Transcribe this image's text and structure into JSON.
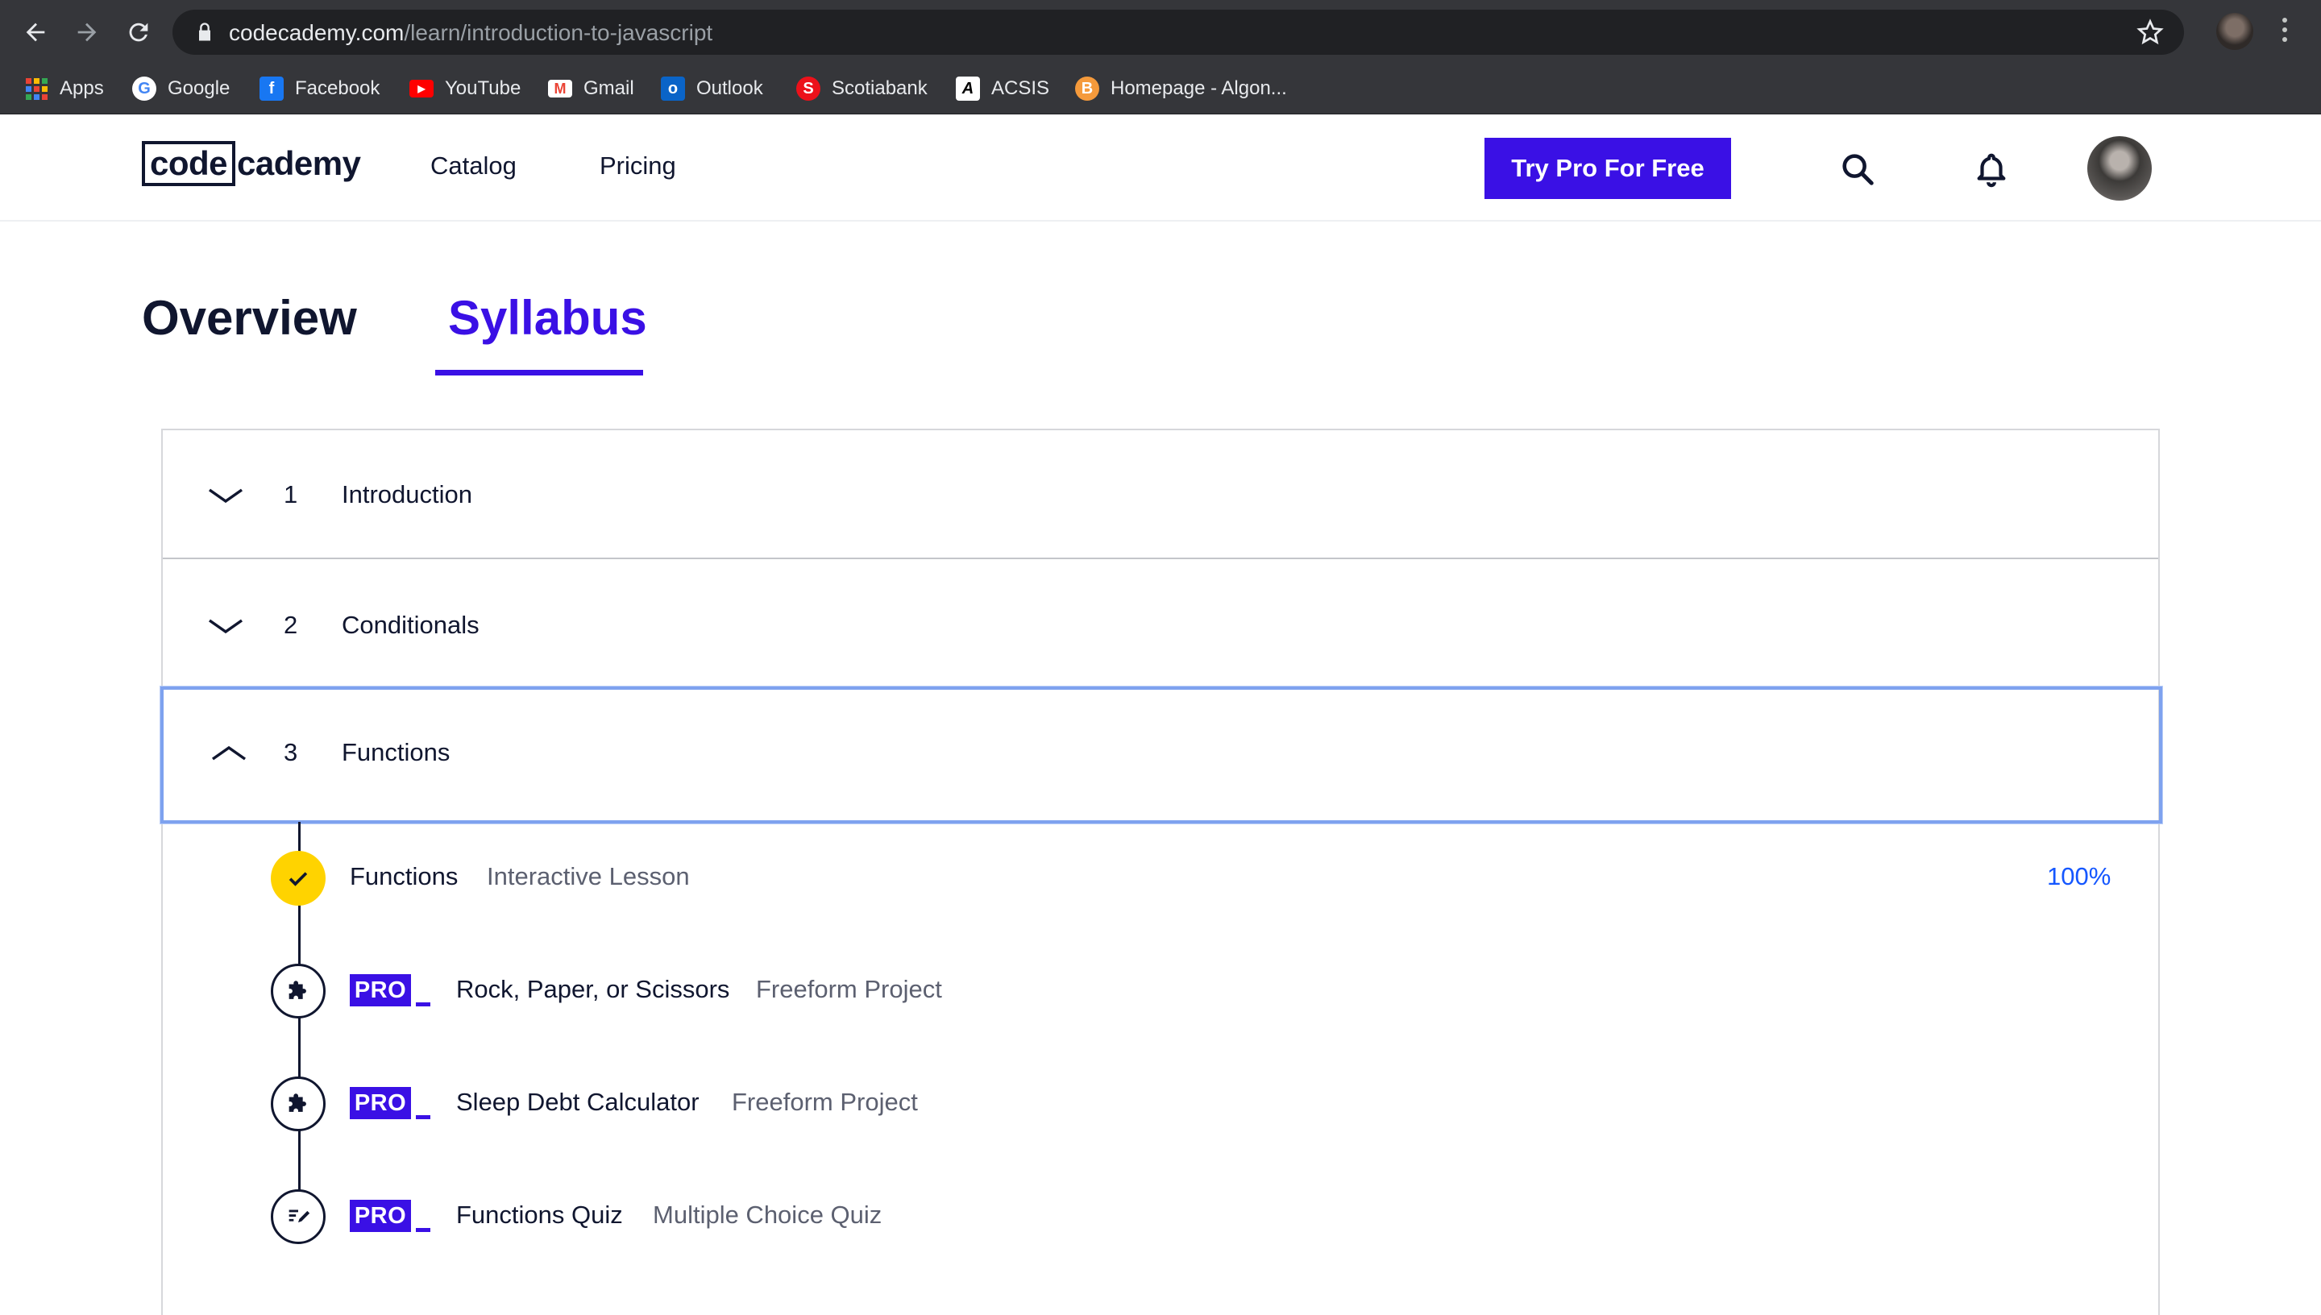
{
  "browser": {
    "url_host": "codecademy.com",
    "url_path": "/learn/introduction-to-javascript",
    "bookmarks": [
      {
        "label": "Apps",
        "icon": "apps-grid-icon"
      },
      {
        "label": "Google",
        "icon": "google-icon"
      },
      {
        "label": "Facebook",
        "icon": "facebook-icon"
      },
      {
        "label": "YouTube",
        "icon": "youtube-icon"
      },
      {
        "label": "Gmail",
        "icon": "gmail-icon"
      },
      {
        "label": "Outlook",
        "icon": "outlook-icon"
      },
      {
        "label": "Scotiabank",
        "icon": "scotiabank-icon"
      },
      {
        "label": "ACSIS",
        "icon": "acsis-icon"
      },
      {
        "label": "Homepage - Algon...",
        "icon": "algonquin-icon"
      }
    ]
  },
  "header": {
    "logo_code": "code",
    "logo_rest": "cademy",
    "nav": [
      "Catalog",
      "Pricing"
    ],
    "cta": "Try Pro For Free"
  },
  "tabs": [
    {
      "label": "Overview",
      "active": false
    },
    {
      "label": "Syllabus",
      "active": true
    }
  ],
  "syllabus": {
    "sections": [
      {
        "number": "1",
        "title": "Introduction",
        "expanded": false
      },
      {
        "number": "2",
        "title": "Conditionals",
        "expanded": false
      },
      {
        "number": "3",
        "title": "Functions",
        "expanded": true
      }
    ],
    "items": [
      {
        "title": "Functions",
        "type": "Interactive Lesson",
        "pro": false,
        "status": "complete",
        "progress": "100%",
        "icon": "check-icon"
      },
      {
        "title": "Rock, Paper, or Scissors",
        "type": "Freeform Project",
        "pro": true,
        "pro_label": "PRO",
        "icon": "puzzle-icon"
      },
      {
        "title": "Sleep Debt Calculator",
        "type": "Freeform Project",
        "pro": true,
        "pro_label": "PRO",
        "icon": "puzzle-icon"
      },
      {
        "title": "Functions Quiz",
        "type": "Multiple Choice Quiz",
        "pro": true,
        "pro_label": "PRO",
        "icon": "quiz-pencil-icon"
      }
    ]
  },
  "colors": {
    "brand_purple": "#3a10e5",
    "navy": "#10162f",
    "complete_yellow": "#ffd300",
    "progress_blue": "#1557ff",
    "focus_ring": "#7ea2ef"
  }
}
